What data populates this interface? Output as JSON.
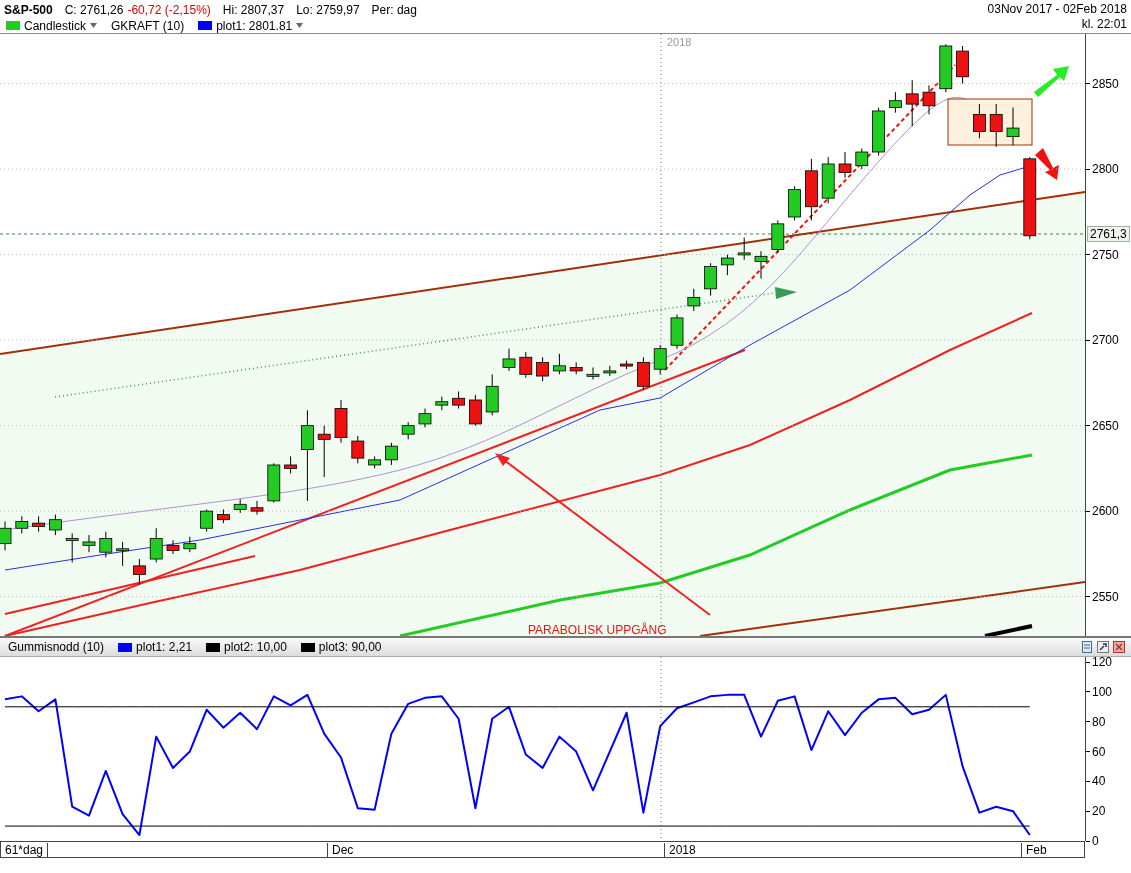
{
  "header": {
    "symbol": "S&P-500",
    "close": "C: 2761,26",
    "change": "-60,72 (-2,15%)",
    "high": "Hi: 2807,37",
    "low": "Lo: 2759,97",
    "period": "Per: dag",
    "date_range": "03Nov 2017 - 02Feb 2018",
    "time": "kl. 22:01"
  },
  "main_legend": [
    {
      "label": "Candlestick",
      "color": "#22cc22",
      "dropdown": true
    },
    {
      "label": "GKRAFT (10)"
    },
    {
      "label": "plot1: 2801.81",
      "color": "#0000ff",
      "dropdown": true
    }
  ],
  "main_chart": {
    "year_marker": "2018",
    "annotation": "PARABOLISK UPPGÅNG",
    "last_price": "2761,3",
    "chart_data": {
      "type": "candlestick",
      "ylim": [
        2527,
        2879
      ],
      "yticks": [
        2850,
        2800,
        2750,
        2700,
        2650,
        2600,
        2550
      ],
      "grid": true,
      "ohlc": [
        [
          2581,
          2594,
          2577,
          2590
        ],
        [
          2590,
          2597,
          2587,
          2594
        ],
        [
          2593,
          2597,
          2588,
          2591
        ],
        [
          2589,
          2598,
          2586,
          2595
        ],
        [
          2584,
          2587,
          2570,
          2584
        ],
        [
          2580,
          2586,
          2576,
          2582
        ],
        [
          2576,
          2588,
          2573,
          2584
        ],
        [
          2578,
          2582,
          2568,
          2578
        ],
        [
          2568,
          2572,
          2557,
          2563
        ],
        [
          2572,
          2590,
          2570,
          2584
        ],
        [
          2580,
          2583,
          2575,
          2577
        ],
        [
          2578,
          2585,
          2576,
          2581
        ],
        [
          2590,
          2601,
          2588,
          2600
        ],
        [
          2598,
          2601,
          2593,
          2595
        ],
        [
          2601,
          2607,
          2599,
          2604
        ],
        [
          2602,
          2606,
          2598,
          2600
        ],
        [
          2606,
          2628,
          2605,
          2627
        ],
        [
          2627,
          2632,
          2622,
          2625
        ],
        [
          2636,
          2659,
          2606,
          2650
        ],
        [
          2645,
          2650,
          2620,
          2642
        ],
        [
          2660,
          2665,
          2640,
          2643
        ],
        [
          2641,
          2644,
          2628,
          2631
        ],
        [
          2627,
          2632,
          2625,
          2630
        ],
        [
          2630,
          2640,
          2627,
          2638
        ],
        [
          2645,
          2652,
          2642,
          2650
        ],
        [
          2651,
          2660,
          2649,
          2657
        ],
        [
          2662,
          2667,
          2659,
          2664
        ],
        [
          2666,
          2670,
          2660,
          2662
        ],
        [
          2665,
          2668,
          2650,
          2651
        ],
        [
          2658,
          2680,
          2656,
          2673
        ],
        [
          2684,
          2695,
          2682,
          2689
        ],
        [
          2690,
          2693,
          2678,
          2680
        ],
        [
          2687,
          2690,
          2676,
          2679
        ],
        [
          2682,
          2692,
          2680,
          2685
        ],
        [
          2684,
          2687,
          2680,
          2682
        ],
        [
          2680,
          2684,
          2677,
          2680
        ],
        [
          2682,
          2685,
          2679,
          2682
        ],
        [
          2686,
          2688,
          2683,
          2685
        ],
        [
          2687,
          2690,
          2671,
          2673
        ],
        [
          2683,
          2697,
          2680,
          2695
        ],
        [
          2697,
          2715,
          2695,
          2713
        ],
        [
          2720,
          2730,
          2717,
          2725
        ],
        [
          2730,
          2745,
          2726,
          2743
        ],
        [
          2744,
          2750,
          2738,
          2748
        ],
        [
          2751,
          2760,
          2747,
          2751
        ],
        [
          2746,
          2752,
          2736,
          2749
        ],
        [
          2753,
          2770,
          2751,
          2768
        ],
        [
          2772,
          2790,
          2770,
          2788
        ],
        [
          2799,
          2806,
          2770,
          2778
        ],
        [
          2783,
          2807,
          2780,
          2803
        ],
        [
          2803,
          2810,
          2795,
          2798
        ],
        [
          2802,
          2812,
          2800,
          2810
        ],
        [
          2810,
          2836,
          2808,
          2834
        ],
        [
          2836,
          2845,
          2833,
          2840
        ],
        [
          2844,
          2852,
          2825,
          2838
        ],
        [
          2845,
          2849,
          2832,
          2837
        ],
        [
          2847,
          2873,
          2845,
          2872
        ],
        [
          2869,
          2872,
          2850,
          2854
        ],
        [
          2832,
          2838,
          2818,
          2822
        ],
        [
          2832,
          2838,
          2813,
          2822
        ],
        [
          2819,
          2836,
          2814,
          2824
        ],
        [
          2806,
          2807,
          2759,
          2761
        ]
      ]
    }
  },
  "lower_panel": {
    "legend": [
      {
        "label": "Gummisnodd (10)"
      },
      {
        "label": "plot1: 2,21",
        "color": "#0000ff"
      },
      {
        "label": "plot2: 10,00",
        "color": "#000000"
      },
      {
        "label": "plot3: 90,00",
        "color": "#000000"
      }
    ],
    "chart_data": {
      "type": "line",
      "ylim": [
        0,
        123.4
      ],
      "yticks": [
        120,
        100,
        80,
        60,
        40,
        20,
        0
      ],
      "series": [
        {
          "color": "#0000ff",
          "values": [
            95,
            97,
            87,
            95,
            23,
            17,
            47,
            18,
            4,
            70,
            49,
            60,
            88,
            76,
            86,
            75,
            97,
            91,
            98,
            72,
            56,
            22,
            21,
            72,
            92,
            96,
            97,
            82,
            22,
            82,
            90,
            58,
            49,
            70,
            60,
            34,
            60,
            86,
            19,
            77,
            89,
            93,
            97,
            98,
            98,
            70,
            94,
            97,
            61,
            87,
            71,
            86,
            95,
            96,
            85,
            88,
            98,
            50,
            19,
            23,
            20,
            4
          ]
        },
        {
          "color": "#000000",
          "values": [
            10,
            10,
            10,
            10,
            10,
            10,
            10,
            10,
            10,
            10,
            10,
            10,
            10,
            10,
            10,
            10,
            10,
            10,
            10,
            10,
            10,
            10,
            10,
            10,
            10,
            10,
            10,
            10,
            10,
            10,
            10,
            10,
            10,
            10,
            10,
            10,
            10,
            10,
            10,
            10,
            10,
            10,
            10,
            10,
            10,
            10,
            10,
            10,
            10,
            10,
            10,
            10,
            10,
            10,
            10,
            10,
            10,
            10,
            10,
            10,
            10,
            10
          ]
        },
        {
          "color": "#000000",
          "values": [
            90,
            90,
            90,
            90,
            90,
            90,
            90,
            90,
            90,
            90,
            90,
            90,
            90,
            90,
            90,
            90,
            90,
            90,
            90,
            90,
            90,
            90,
            90,
            90,
            90,
            90,
            90,
            90,
            90,
            90,
            90,
            90,
            90,
            90,
            90,
            90,
            90,
            90,
            90,
            90,
            90,
            90,
            90,
            90,
            90,
            90,
            90,
            90,
            90,
            90,
            90,
            90,
            90,
            90,
            90,
            90,
            90,
            90,
            90,
            90,
            90,
            90
          ]
        }
      ]
    }
  },
  "x_axis": {
    "period": "61*dag",
    "labels": [
      "Dec",
      "2018",
      "Feb"
    ]
  }
}
